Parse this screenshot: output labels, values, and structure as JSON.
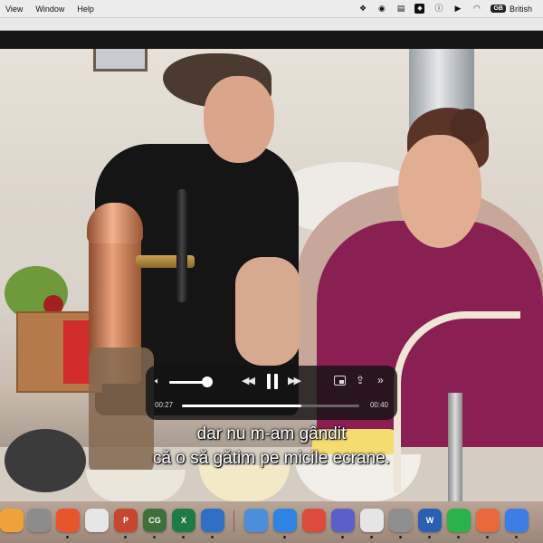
{
  "menubar": {
    "items": [
      "View",
      "Window",
      "Help"
    ],
    "status_icons": [
      "dropbox-icon",
      "camera-icon",
      "clipboard-icon",
      "vpn-icon",
      "info-icon",
      "play-icon",
      "wifi-icon"
    ],
    "keyboard_badge": "GB",
    "input_source": "British"
  },
  "subtitles": {
    "line1": "dar nu m-am gândit",
    "line2": "că o să gătim pe micile ecrane."
  },
  "player": {
    "current_time": "00:27",
    "duration": "00:40",
    "progress": 0.675,
    "volume": 0.8,
    "state": "playing"
  },
  "dock": {
    "apps": [
      {
        "name": "photos-icon",
        "label": "",
        "color": "#f0a23a"
      },
      {
        "name": "disk-utility-icon",
        "label": "",
        "color": "#8c8c8c"
      },
      {
        "name": "firefox-icon",
        "label": "",
        "color": "#e8552b"
      },
      {
        "name": "microsoft-office-icon",
        "label": "",
        "color": "#e6e6e6"
      },
      {
        "name": "powerpoint-icon",
        "label": "P",
        "color": "#c8452f"
      },
      {
        "name": "cg-app-icon",
        "label": "CG",
        "color": "#3f6f3a"
      },
      {
        "name": "excel-icon",
        "label": "X",
        "color": "#1f7a44"
      },
      {
        "name": "mail-app-icon",
        "label": "",
        "color": "#2f6fc4"
      },
      {
        "name": "migration-icon",
        "label": "",
        "color": "#4a8fd9"
      },
      {
        "name": "safari-icon",
        "label": "",
        "color": "#2e84e0"
      },
      {
        "name": "todoist-icon",
        "label": "",
        "color": "#db4c3f"
      },
      {
        "name": "teams-icon",
        "label": "",
        "color": "#5b5fc7"
      },
      {
        "name": "chrome-icon",
        "label": "",
        "color": "#e5e5e5"
      },
      {
        "name": "system-settings-icon",
        "label": "",
        "color": "#8f8f8f"
      },
      {
        "name": "word-icon",
        "label": "W",
        "color": "#2b5fb3"
      },
      {
        "name": "whatsapp-icon",
        "label": "",
        "color": "#29b34a"
      },
      {
        "name": "perplexity-icon",
        "label": "",
        "color": "#e86a3c"
      },
      {
        "name": "quicktime-icon",
        "label": "",
        "color": "#3d7ee6"
      }
    ]
  }
}
